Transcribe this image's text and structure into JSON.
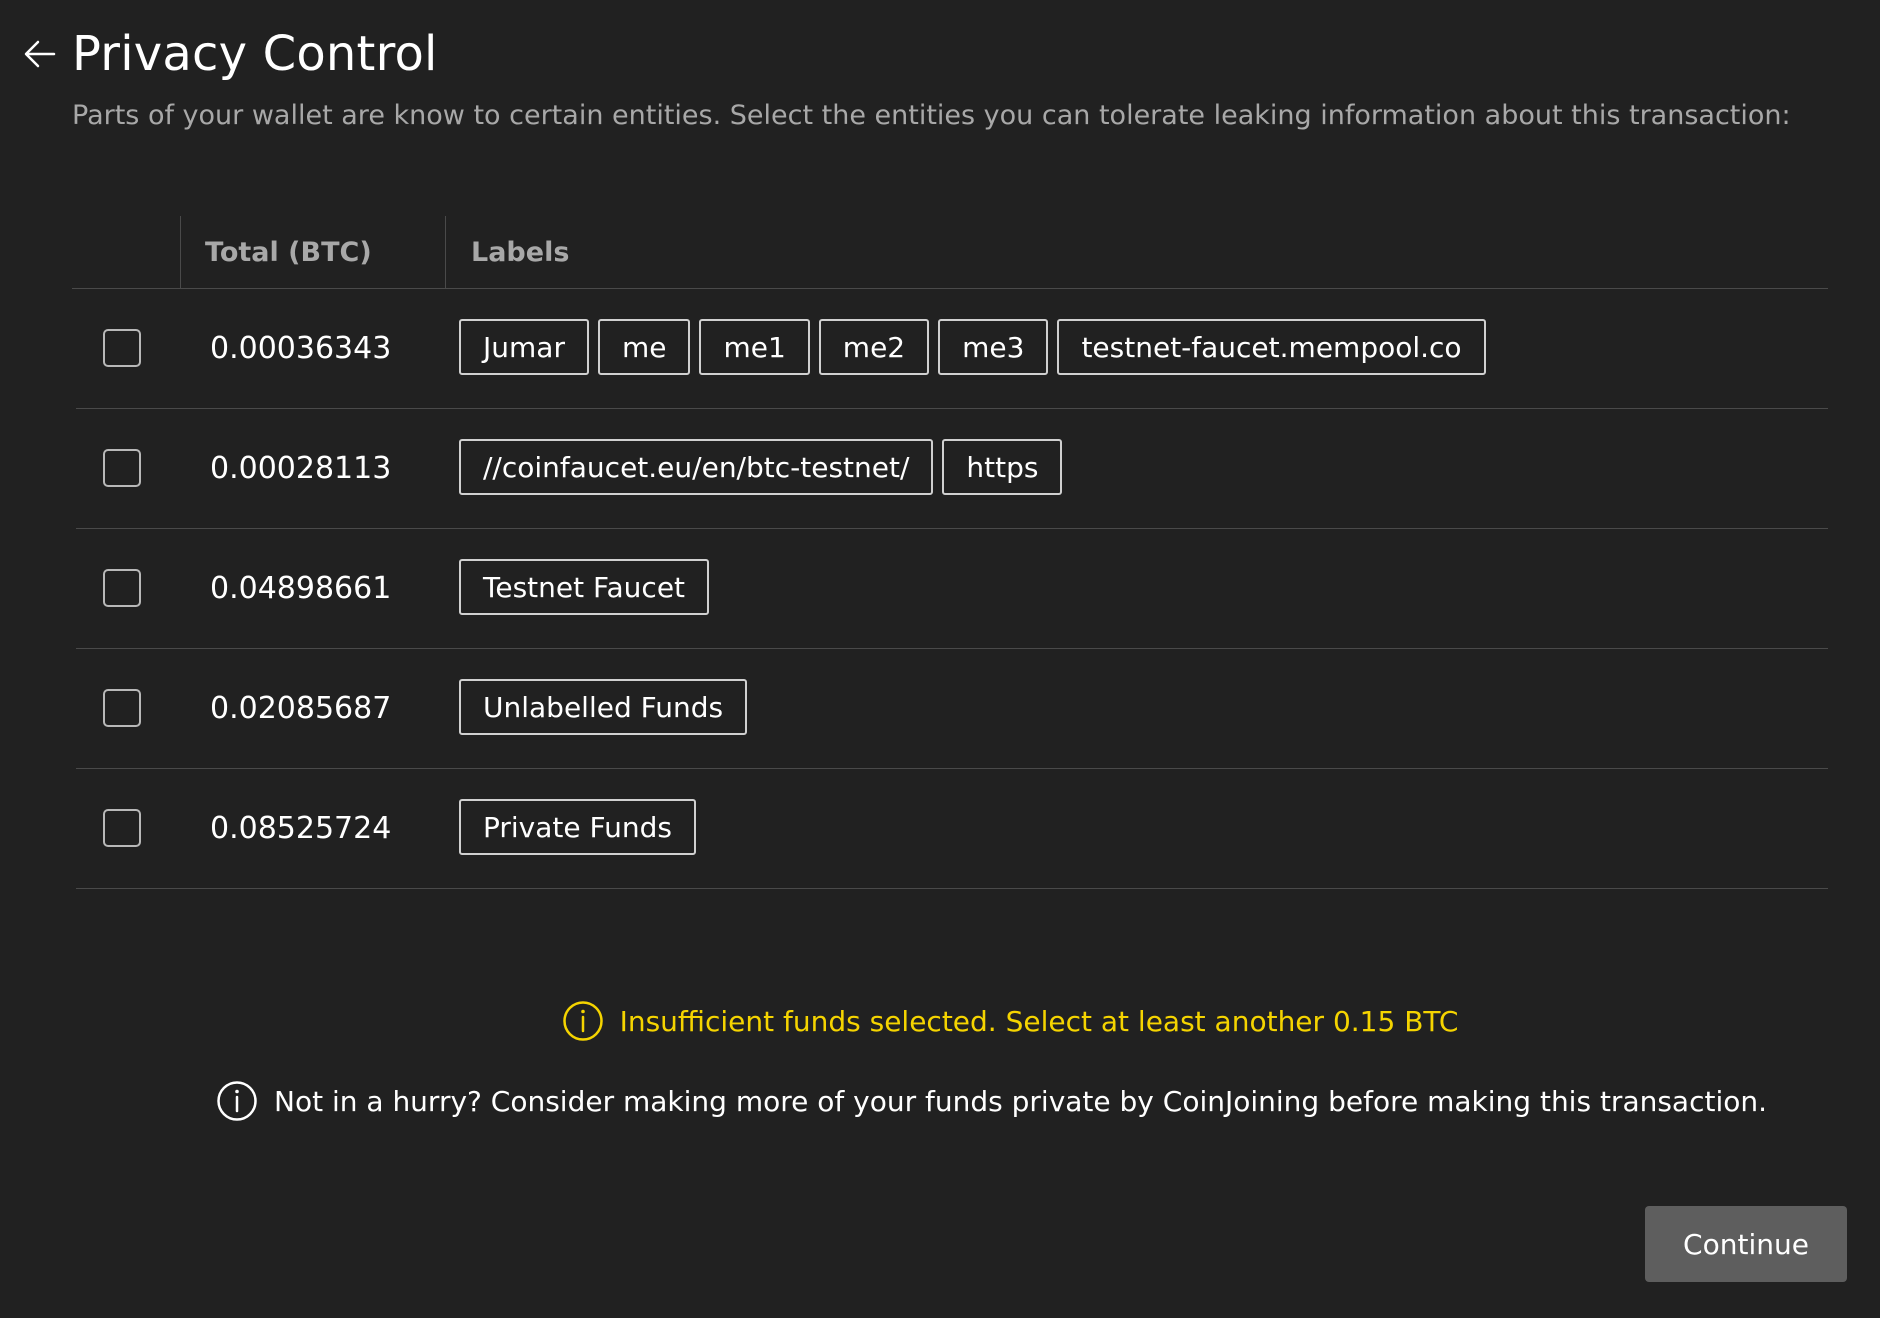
{
  "header": {
    "title": "Privacy Control",
    "subtitle": "Parts of your wallet are know to certain entities. Select the entities you can tolerate leaking information about this transaction:"
  },
  "table": {
    "columns": [
      "",
      "Total (BTC)",
      "Labels"
    ],
    "rows": [
      {
        "checked": false,
        "total": "0.00036343",
        "labels": [
          "Jumar",
          "me",
          "me1",
          "me2",
          "me3",
          "testnet-faucet.mempool.co"
        ]
      },
      {
        "checked": false,
        "total": "0.00028113",
        "labels": [
          "//coinfaucet.eu/en/btc-testnet/",
          "https"
        ]
      },
      {
        "checked": false,
        "total": "0.04898661",
        "labels": [
          "Testnet Faucet"
        ]
      },
      {
        "checked": false,
        "total": "0.02085687",
        "labels": [
          "Unlabelled Funds"
        ]
      },
      {
        "checked": false,
        "total": "0.08525724",
        "labels": [
          "Private Funds"
        ]
      }
    ]
  },
  "warning": {
    "text": "Insufficient funds selected. Select at least another 0.15 BTC",
    "icon": "info-circle-icon",
    "color": "#f5d400"
  },
  "info": {
    "text": "Not in a hurry? Consider making more of your funds private by CoinJoining before making this transaction.",
    "icon": "info-circle-icon"
  },
  "actions": {
    "continue_label": "Continue"
  },
  "colors": {
    "background": "#212121",
    "muted_text": "#a8a8a8",
    "button_bg": "#5e5e5e"
  }
}
